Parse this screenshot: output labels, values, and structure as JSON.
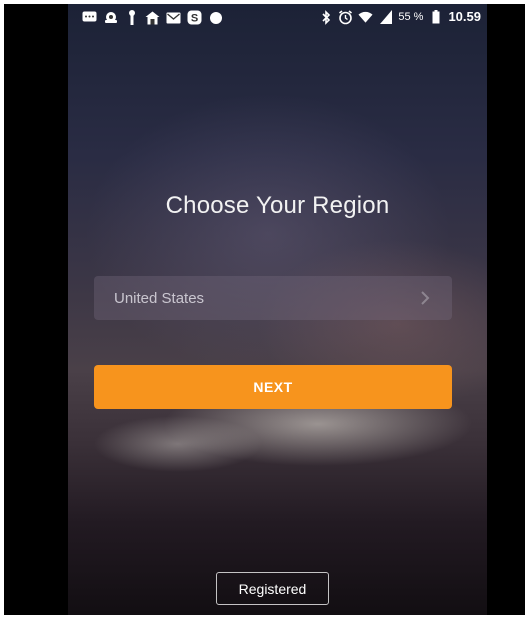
{
  "status_bar": {
    "left_icons": [
      "messages-icon",
      "cloud-icon",
      "usb-icon",
      "home-icon",
      "mail-icon",
      "skype-icon",
      "dot-icon"
    ],
    "right_icons": [
      "bluetooth-icon",
      "alarm-icon",
      "wifi-icon",
      "signal-icon",
      "battery-icon"
    ],
    "battery": "55 %",
    "time": "10.59"
  },
  "main": {
    "title": "Choose Your Region",
    "region_select": {
      "value": "United States"
    },
    "next_label": "NEXT",
    "registered_label": "Registered"
  },
  "colors": {
    "accent": "#f7941d",
    "text": "#ffffff"
  }
}
